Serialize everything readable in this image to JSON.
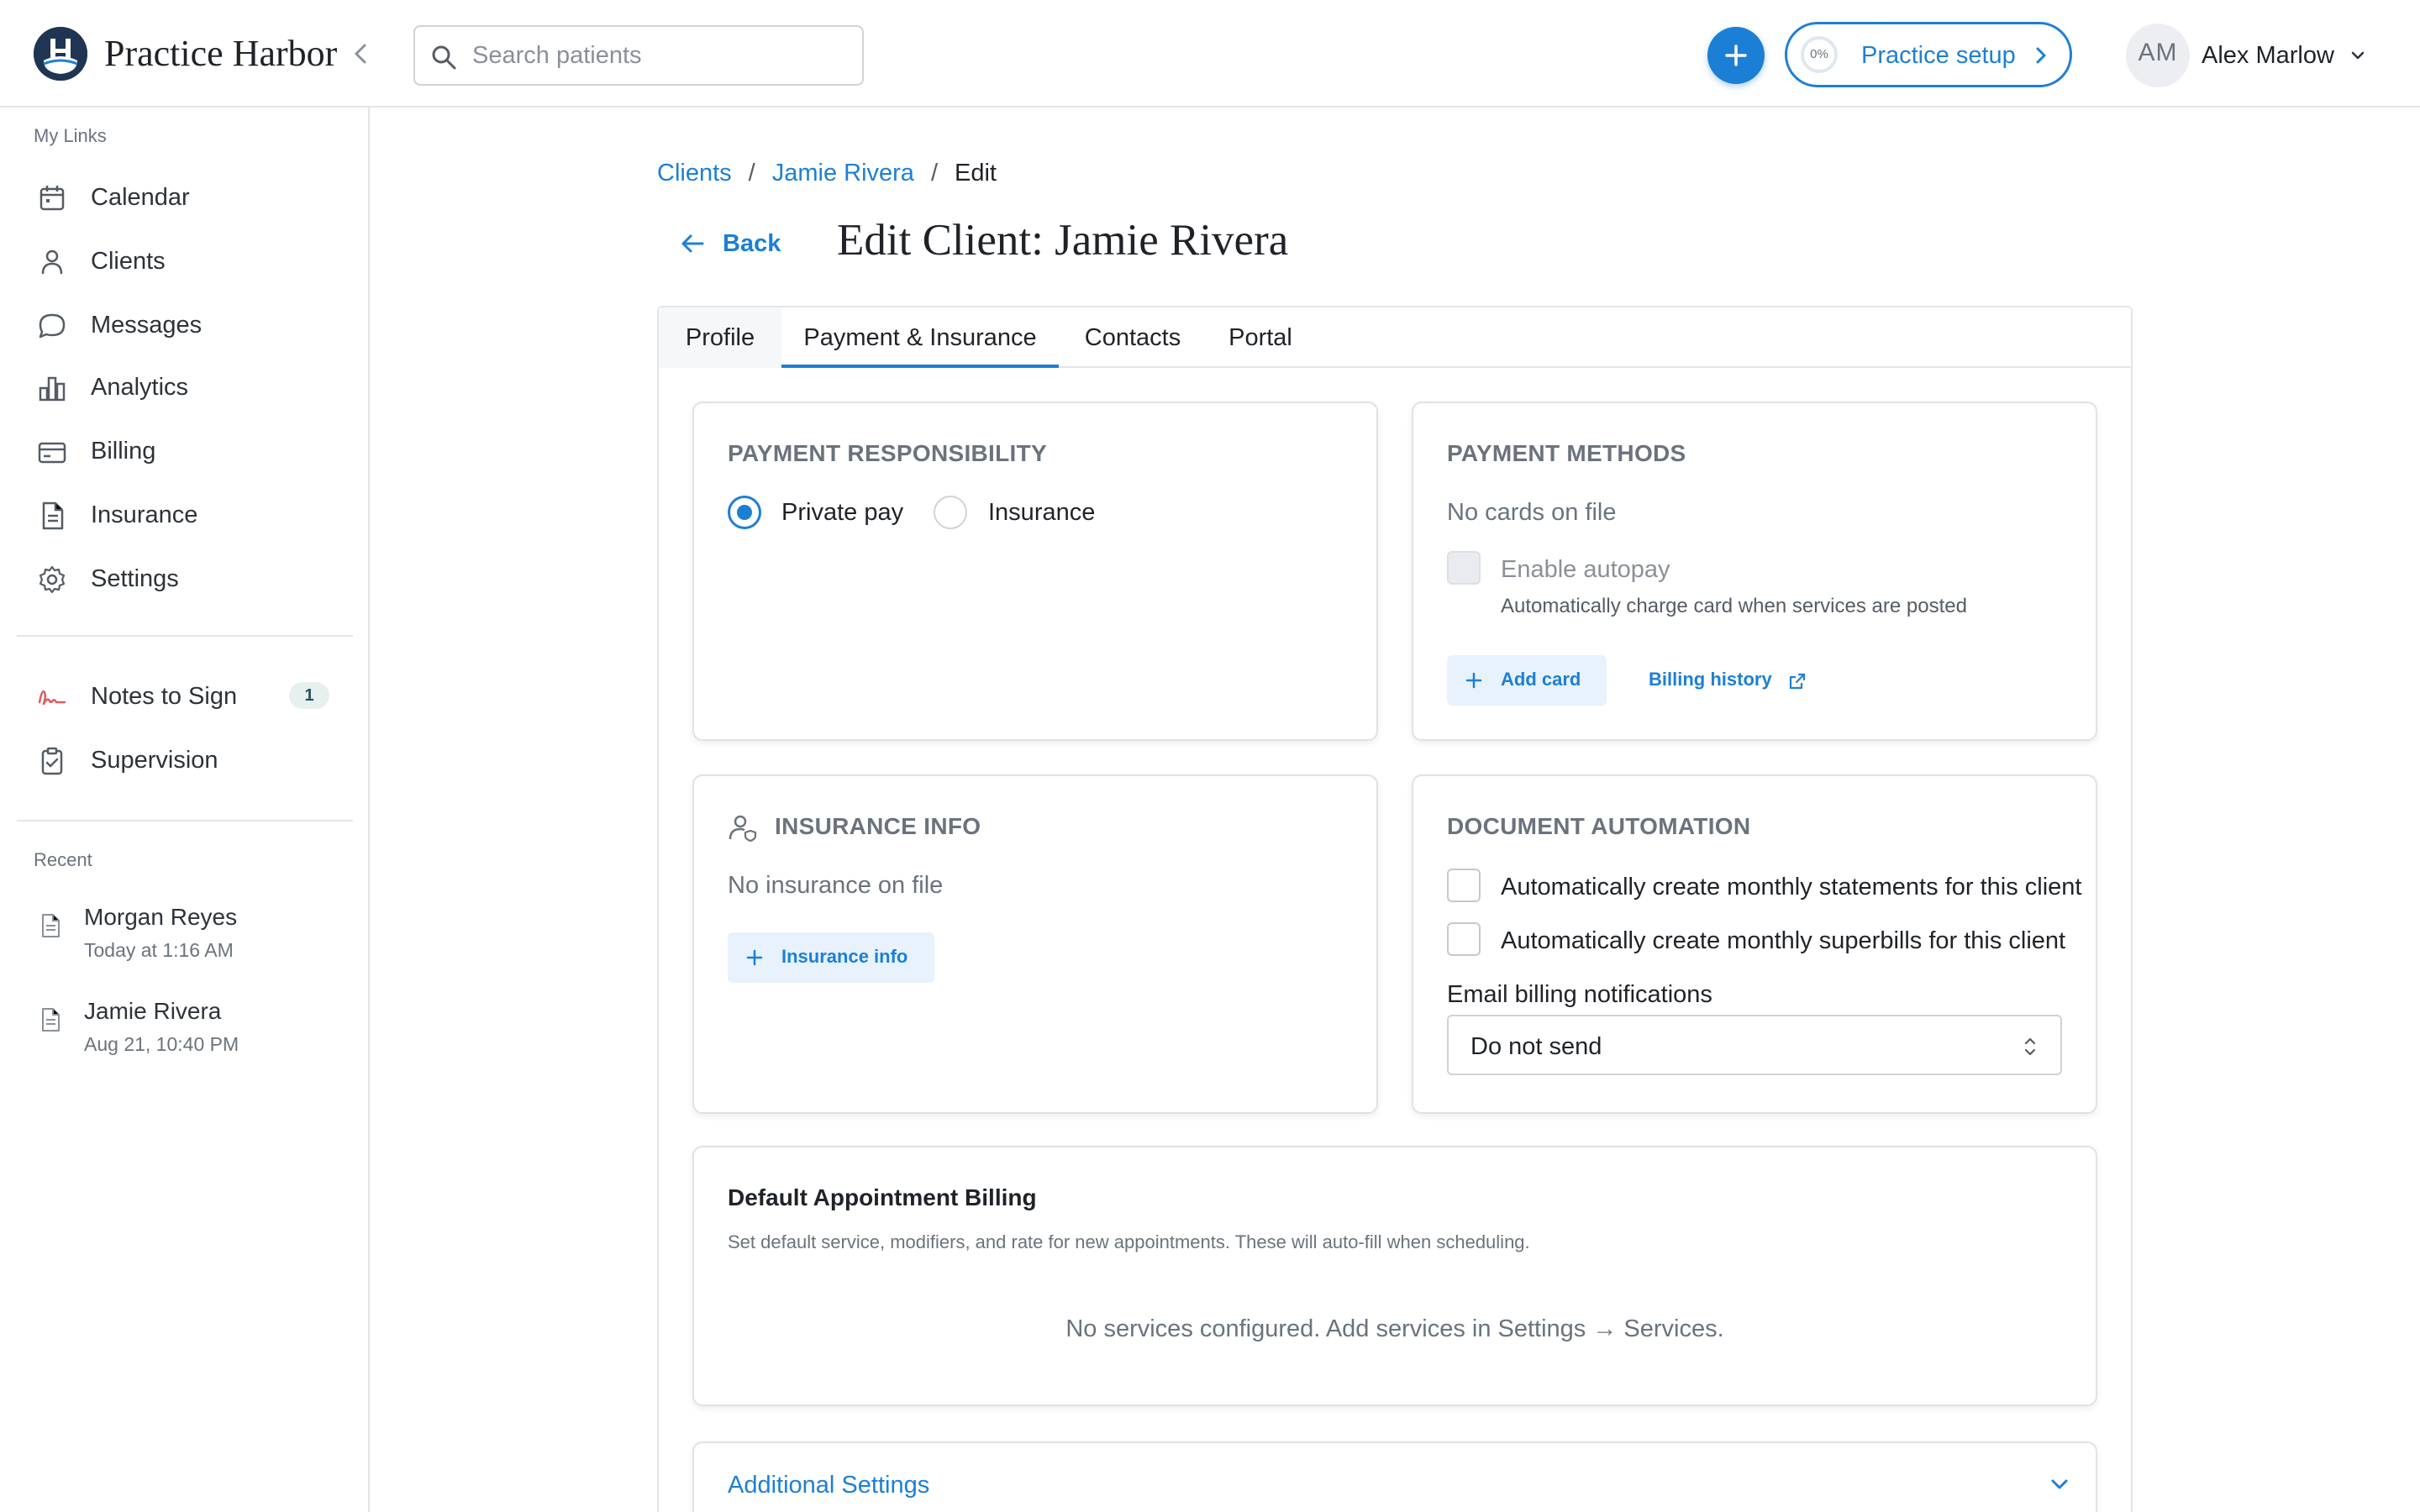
{
  "app": {
    "brand": "Practice Harbor",
    "search_placeholder": "Search patients",
    "setup_progress": "0%",
    "setup_label": "Practice setup",
    "user_initials": "AM",
    "user_name": "Alex Marlow",
    "accent_color": "#1c7fd6"
  },
  "sidebar": {
    "my_links_heading": "My Links",
    "links": [
      {
        "label": "Calendar",
        "icon": "calendar-icon"
      },
      {
        "label": "Clients",
        "icon": "user-icon"
      },
      {
        "label": "Messages",
        "icon": "message-icon"
      },
      {
        "label": "Analytics",
        "icon": "bar-chart-icon"
      },
      {
        "label": "Billing",
        "icon": "credit-card-icon"
      },
      {
        "label": "Insurance",
        "icon": "document-icon"
      },
      {
        "label": "Settings",
        "icon": "gear-icon"
      }
    ],
    "notes_to_sign": {
      "label": "Notes to Sign",
      "count": "1",
      "icon": "signature-icon"
    },
    "supervision": {
      "label": "Supervision",
      "icon": "clipboard-check-icon"
    },
    "recent_heading": "Recent",
    "recent": [
      {
        "name": "Morgan Reyes",
        "time": "Today at 1:16 AM"
      },
      {
        "name": "Jamie Rivera",
        "time": "Aug 21, 10:40 PM"
      }
    ]
  },
  "main": {
    "breadcrumb": [
      "Clients",
      "Jamie Rivera",
      "Edit"
    ],
    "back_label": "Back",
    "title": "Edit Client: Jamie Rivera",
    "tabs": [
      "Profile",
      "Payment & Insurance",
      "Contacts",
      "Portal"
    ],
    "active_tab": "Payment & Insurance"
  },
  "payment_responsibility": {
    "title": "PAYMENT RESPONSIBILITY",
    "options": [
      "Private pay",
      "Insurance"
    ],
    "selected": "Private pay"
  },
  "payment_methods": {
    "title": "PAYMENT METHODS",
    "empty_text": "No cards on file",
    "autopay_label": "Enable autopay",
    "autopay_note": "Automatically charge card when services are posted",
    "add_card_label": "Add card",
    "billing_history_label": "Billing history"
  },
  "insurance_info": {
    "title": "INSURANCE INFO",
    "empty_text": "No insurance on file",
    "button_label": "Insurance info"
  },
  "document_automation": {
    "title": "DOCUMENT AUTOMATION",
    "statements_label": "Automatically create monthly statements for this client",
    "superbills_label": "Automatically create monthly superbills for this client",
    "email_label": "Email billing notifications",
    "email_value": "Do not send"
  },
  "default_billing": {
    "title": "Default Appointment Billing",
    "subtitle": "Set default service, modifiers, and rate for new appointments. These will auto-fill when scheduling.",
    "empty_text": "No services configured. Add services in Settings → Services."
  },
  "additional_settings": {
    "label": "Additional Settings"
  }
}
